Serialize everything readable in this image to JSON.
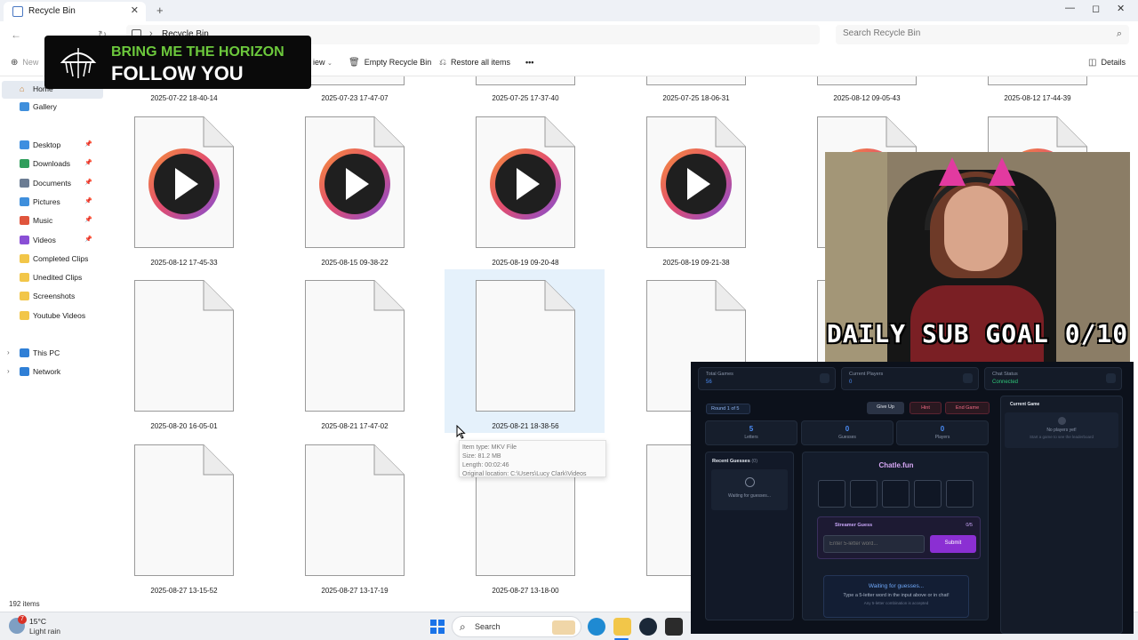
{
  "window": {
    "tab_title": "Recycle Bin",
    "new_tab": "+",
    "controls": {
      "minimize": "—",
      "maximize": "◻",
      "close": "✕"
    }
  },
  "address": {
    "breadcrumb": "Recycle Bin",
    "search_placeholder": "Search Recycle Bin"
  },
  "commandbar": {
    "new_label": "New",
    "view_label": "iew",
    "empty_label": "Empty Recycle Bin",
    "restore_label": "Restore all items",
    "more_label": "•••",
    "details_label": "Details"
  },
  "sidebar": {
    "home": "Home",
    "gallery": "Gallery",
    "items": [
      {
        "label": "Desktop",
        "icon": "desktop-icon",
        "pinned": true
      },
      {
        "label": "Downloads",
        "icon": "download-icon",
        "pinned": true
      },
      {
        "label": "Documents",
        "icon": "document-icon",
        "pinned": true
      },
      {
        "label": "Pictures",
        "icon": "picture-icon",
        "pinned": true
      },
      {
        "label": "Music",
        "icon": "music-icon",
        "pinned": true
      },
      {
        "label": "Videos",
        "icon": "video-icon",
        "pinned": true
      },
      {
        "label": "Completed Clips",
        "icon": "folder-icon",
        "pinned": false
      },
      {
        "label": "Unedited Clips",
        "icon": "folder-icon",
        "pinned": false
      },
      {
        "label": "Screenshots",
        "icon": "folder-icon",
        "pinned": false
      },
      {
        "label": "Youtube Videos",
        "icon": "folder-icon",
        "pinned": false
      }
    ],
    "this_pc": "This PC",
    "network": "Network"
  },
  "files": {
    "row0": [
      "2025-07-22 18-40-14",
      "2025-07-23 17-47-07",
      "2025-07-25 17-37-40",
      "2025-07-25 18-06-31",
      "2025-08-12 09-05-43",
      "2025-08-12 17-44-39"
    ],
    "row1": [
      "2025-08-12 17-45-33",
      "2025-08-15 09-38-22",
      "2025-08-19 09-20-48",
      "2025-08-19 09-21-38"
    ],
    "row2": [
      "2025-08-20 16-05-01",
      "2025-08-21 17-47-02",
      "2025-08-21 18-38-56",
      "2025-08-"
    ],
    "row3": [
      "2025-08-27 13-15-52",
      "2025-08-27 13-17-19",
      "2025-08-27 13-18-00",
      "2025-08-"
    ]
  },
  "tooltip": {
    "type": "Item type: MKV File",
    "size": "Size: 81.2 MB",
    "length": "Length: 00:02:46",
    "location": "Original location: C:\\Users\\Lucy Clark\\Videos"
  },
  "status": {
    "items_count": "192 items"
  },
  "taskbar": {
    "temperature": "15°C",
    "condition": "Light rain",
    "weather_badge": "7",
    "search_label": "Search"
  },
  "banner": {
    "line1": "BRING ME THE HORIZON",
    "line2": "FOLLOW YOU"
  },
  "webcam": {
    "goal_text": "DAILY SUB GOAL 0/10"
  },
  "game": {
    "stats": [
      {
        "label": "Total Games",
        "value": "56"
      },
      {
        "label": "Current Players",
        "value": "0"
      },
      {
        "label": "Chat Status",
        "value": "Connected"
      }
    ],
    "round": "Round 1 of 5",
    "buttons": {
      "give_up": "Give Up",
      "hint": "Hint",
      "end_game": "End Game"
    },
    "counters": [
      {
        "value": "5",
        "label": "Letters"
      },
      {
        "value": "0",
        "label": "Guesses"
      },
      {
        "value": "0",
        "label": "Players"
      }
    ],
    "recent_title": "Recent Guesses",
    "recent_count": "(0)",
    "recent_waiting": "Waiting for guesses...",
    "title": "Chatle.fun",
    "streamer_guess": "Streamer Guess",
    "streamer_count": "0/5",
    "input_placeholder": "Enter 5-letter word...",
    "submit": "Submit",
    "waiting_title": "Waiting for guesses...",
    "waiting_sub": "Type a 5-letter word in the input above or in chat!",
    "waiting_note": "Any 5-letter combination is accepted",
    "current_game_title": "Current Game",
    "no_players": "No players yet!",
    "no_players_sub": "Start a game to see the leaderboard",
    "colors": {
      "accent": "#8b2fd3",
      "blue": "#4b8df7",
      "panel": "#0c111b"
    }
  },
  "colors": {
    "selection": "#e5f1fb",
    "taskbar": "#eef0f3",
    "banner_green": "#6cc83c",
    "cat_ears": "#e23aa0"
  }
}
